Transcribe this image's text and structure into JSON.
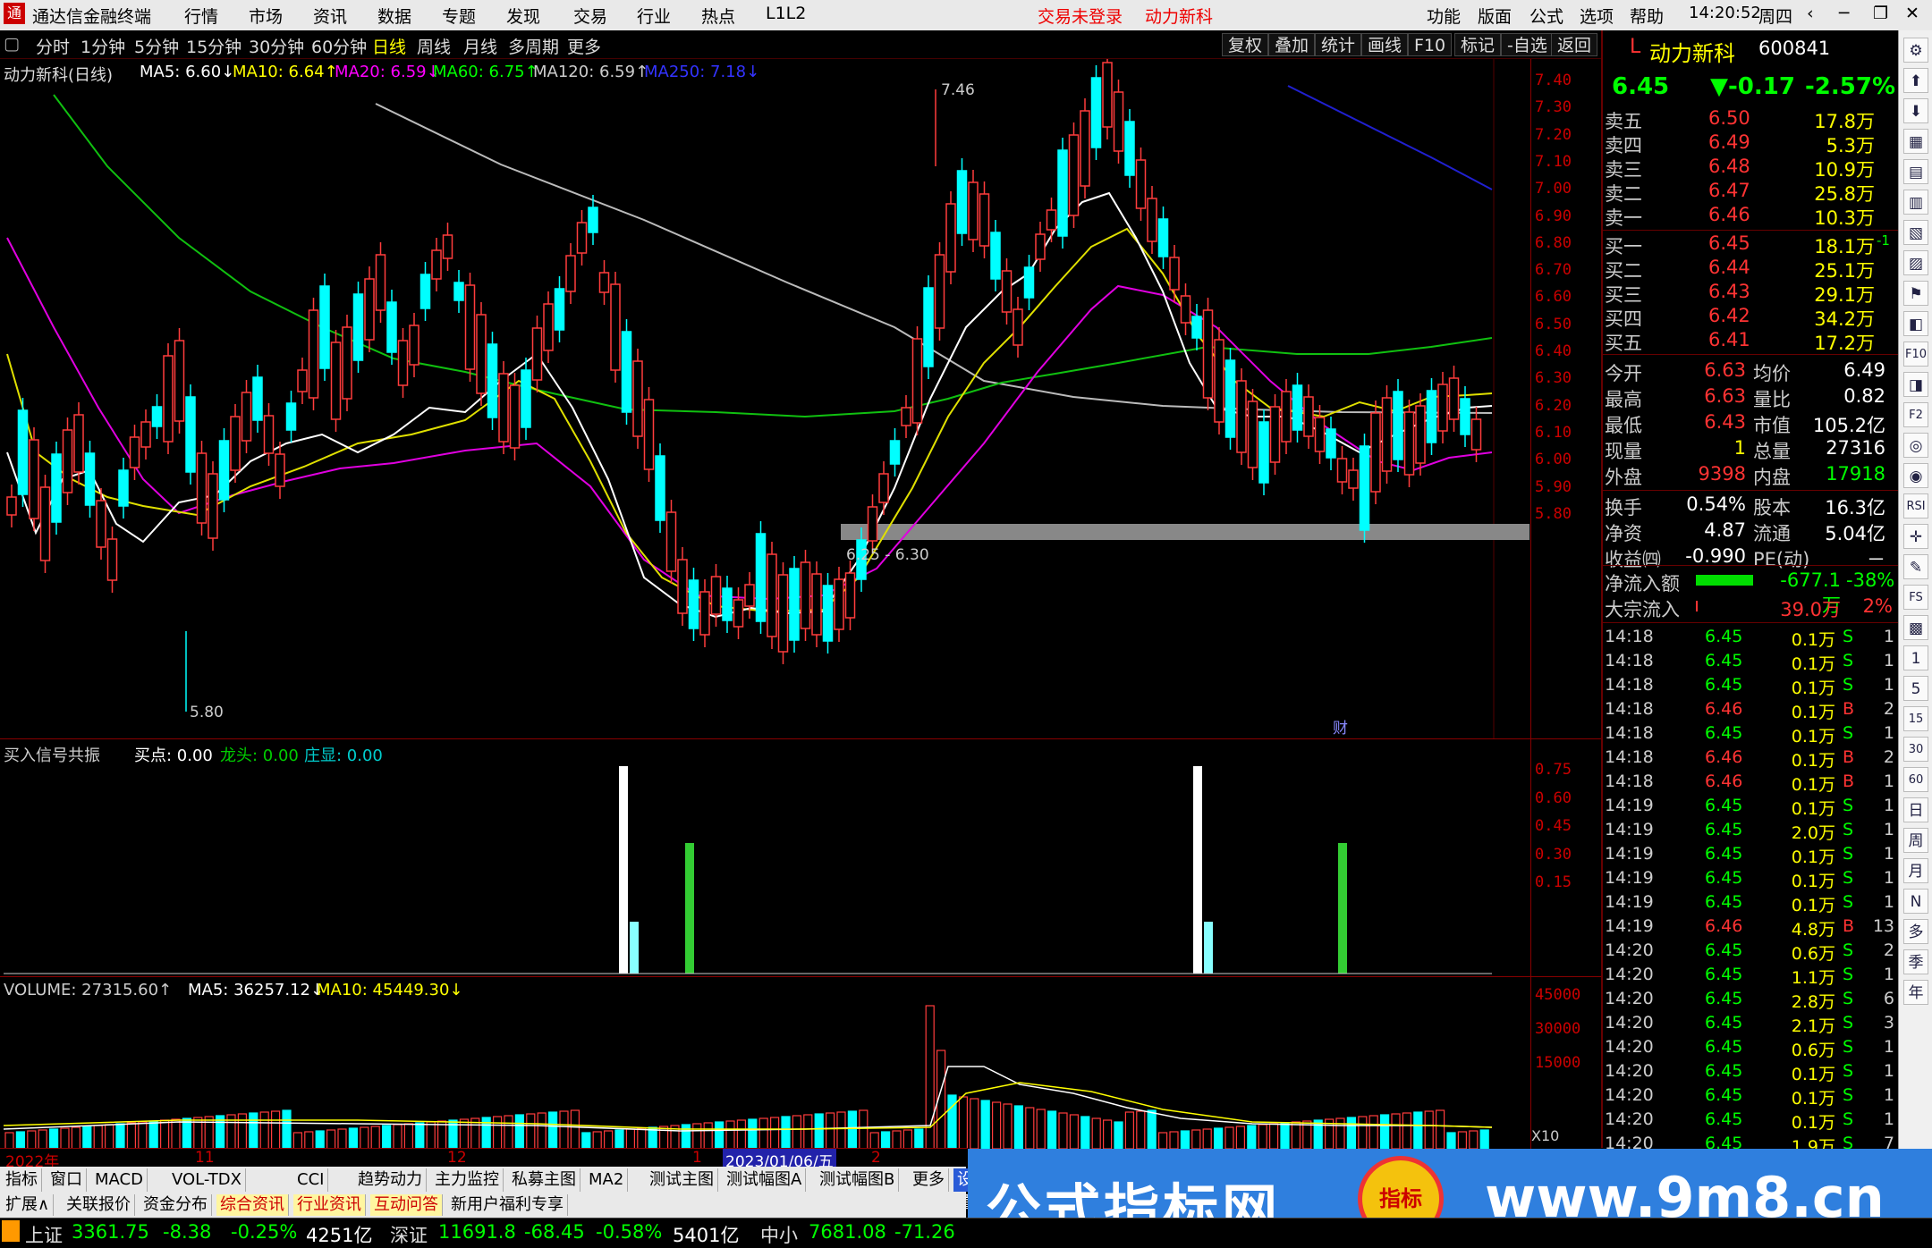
{
  "menubar": {
    "app": "通达信金融终端",
    "menus": [
      "行情",
      "市场",
      "资讯",
      "数据",
      "专题",
      "发现",
      "交易",
      "行业",
      "热点",
      "L1L2"
    ],
    "notice1": "交易未登录",
    "notice2": "动力新科",
    "right": [
      "功能",
      "版面",
      "公式",
      "选项",
      "帮助"
    ],
    "time": "14:20:52",
    "weekday": "周四"
  },
  "period": {
    "items": [
      "分时",
      "1分钟",
      "5分钟",
      "15分钟",
      "30分钟",
      "60分钟",
      "日线",
      "周线",
      "月线",
      "多周期",
      "更多"
    ],
    "active": "日线",
    "tools": [
      "复权",
      "叠加",
      "统计",
      "画线",
      "F10",
      "标记",
      "-自选",
      "返回"
    ]
  },
  "main": {
    "title": "动力新科(日线)",
    "ma": [
      {
        "label": "MA5: 6.60↓",
        "color": "#ffffff"
      },
      {
        "label": "MA10: 6.64↑",
        "color": "#ffff00"
      },
      {
        "label": "MA20: 6.59↓",
        "color": "#ff00ff"
      },
      {
        "label": "MA60: 6.75↑",
        "color": "#00ff00"
      },
      {
        "label": "MA120: 6.59↑",
        "color": "#cccccc"
      },
      {
        "label": "MA250: 7.18↓",
        "color": "#0000ff"
      }
    ],
    "hi_label": "7.46",
    "lo_label": "5.80",
    "zone_label": "6.25 - 6.30",
    "cai": "财"
  },
  "axis_main": [
    "7.40",
    "7.30",
    "7.20",
    "7.10",
    "7.00",
    "6.90",
    "6.80",
    "6.70",
    "6.60",
    "6.50",
    "6.40",
    "6.30",
    "6.20",
    "6.10",
    "6.00",
    "5.90",
    "5.80"
  ],
  "sub": {
    "title": "买入信号共振",
    "a": "买点: 0.00",
    "b": "龙头: 0.00",
    "c": "庄显: 0.00",
    "axis": [
      "0.75",
      "0.60",
      "0.45",
      "0.30",
      "0.15"
    ]
  },
  "vol": {
    "title": "VOLUME: 27315.60↑",
    "ma5": "MA5: 36257.12↓",
    "ma10": "MA10: 45449.30↓",
    "axis": [
      "45000",
      "30000",
      "15000"
    ],
    "unit": "X10"
  },
  "dates": {
    "d1": "2022年",
    "d2": "11",
    "d3": "12",
    "d4": "1",
    "sel": "2023/01/06/五",
    "d5": "2"
  },
  "tabs1": [
    "指标",
    "窗口",
    "MACD",
    "VOL-TDX",
    "CCI",
    "趋势动力",
    "主力监控",
    "私募主图",
    "MA2",
    "测试主图",
    "测试幅图A",
    "测试幅图B",
    "更多",
    "设置"
  ],
  "tabs2": [
    "扩展∧",
    "关联报价",
    "资金分布",
    "综合资讯",
    "行业资讯",
    "互动问答",
    "新用户福利专享"
  ],
  "quote": {
    "name": "动力新科",
    "code": "600841",
    "price": "6.45",
    "chg": "▼-0.17",
    "pct": "-2.57%",
    "sells": [
      {
        "l": "卖五",
        "p": "6.50",
        "v": "17.8万"
      },
      {
        "l": "卖四",
        "p": "6.49",
        "v": "5.3万"
      },
      {
        "l": "卖三",
        "p": "6.48",
        "v": "10.9万"
      },
      {
        "l": "卖二",
        "p": "6.47",
        "v": "25.8万"
      },
      {
        "l": "卖一",
        "p": "6.46",
        "v": "10.3万"
      }
    ],
    "buys": [
      {
        "l": "买一",
        "p": "6.45",
        "v": "18.1万",
        "x": "-1"
      },
      {
        "l": "买二",
        "p": "6.44",
        "v": "25.1万",
        "x": ""
      },
      {
        "l": "买三",
        "p": "6.43",
        "v": "29.1万",
        "x": ""
      },
      {
        "l": "买四",
        "p": "6.42",
        "v": "34.2万",
        "x": ""
      },
      {
        "l": "买五",
        "p": "6.41",
        "v": "17.2万",
        "x": ""
      }
    ],
    "stats": [
      [
        "今开",
        "6.63",
        "均价",
        "6.49"
      ],
      [
        "最高",
        "6.63",
        "量比",
        "0.82"
      ],
      [
        "最低",
        "6.43",
        "市值",
        "105.2亿"
      ],
      [
        "现量",
        "1",
        "总量",
        "27316"
      ],
      [
        "外盘",
        "9398",
        "内盘",
        "17918"
      ]
    ],
    "stats2": [
      [
        "换手",
        "0.54%",
        "股本",
        "16.3亿"
      ],
      [
        "净资",
        "4.87",
        "流通",
        "5.04亿"
      ],
      [
        "收益㈣",
        "-0.990",
        "PE(动)",
        "－"
      ]
    ],
    "flow": [
      {
        "l": "净流入额",
        "v": "-677.1万",
        "p": "-38%"
      },
      {
        "l": "大宗流入",
        "v": "39.0万",
        "p": "2%"
      }
    ]
  },
  "ticks": [
    [
      "14:18",
      "6.45",
      "0.1万",
      "S",
      "1"
    ],
    [
      "14:18",
      "6.45",
      "0.1万",
      "S",
      "1"
    ],
    [
      "14:18",
      "6.45",
      "0.1万",
      "S",
      "1"
    ],
    [
      "14:18",
      "6.46",
      "0.1万",
      "B",
      "2"
    ],
    [
      "14:18",
      "6.45",
      "0.1万",
      "S",
      "1"
    ],
    [
      "14:18",
      "6.46",
      "0.1万",
      "B",
      "2"
    ],
    [
      "14:18",
      "6.46",
      "0.1万",
      "B",
      "1"
    ],
    [
      "14:19",
      "6.45",
      "0.1万",
      "S",
      "1"
    ],
    [
      "14:19",
      "6.45",
      "2.0万",
      "S",
      "1"
    ],
    [
      "14:19",
      "6.45",
      "0.1万",
      "S",
      "1"
    ],
    [
      "14:19",
      "6.45",
      "0.1万",
      "S",
      "1"
    ],
    [
      "14:19",
      "6.45",
      "0.1万",
      "S",
      "1"
    ],
    [
      "14:19",
      "6.46",
      "4.8万",
      "B",
      "13"
    ],
    [
      "14:20",
      "6.45",
      "0.6万",
      "S",
      "2"
    ],
    [
      "14:20",
      "6.45",
      "1.1万",
      "S",
      "1"
    ],
    [
      "14:20",
      "6.45",
      "2.8万",
      "S",
      "6"
    ],
    [
      "14:20",
      "6.45",
      "2.1万",
      "S",
      "3"
    ],
    [
      "14:20",
      "6.45",
      "0.6万",
      "S",
      "1"
    ],
    [
      "14:20",
      "6.45",
      "0.1万",
      "S",
      "1"
    ],
    [
      "14:20",
      "6.45",
      "0.1万",
      "S",
      "1"
    ],
    [
      "14:20",
      "6.45",
      "0.1万",
      "S",
      "1"
    ],
    [
      "14:20",
      "6.45",
      "1.9万",
      "S",
      "7"
    ]
  ],
  "sideicons": [
    "⚙",
    "⬆",
    "⬇",
    "▦",
    "▤",
    "▥",
    "▧",
    "▨",
    "⚑",
    "◧",
    "F10",
    "◨",
    "F2",
    "◎",
    "◉",
    "RSI",
    "✛",
    "✎",
    "FS",
    "▩",
    "1",
    "5",
    "15",
    "30",
    "60",
    "日",
    "周",
    "月",
    "N",
    "多",
    "季",
    "年"
  ],
  "status": {
    "sh": "上证",
    "sh_v": "3361.75",
    "sh_c": "-8.38",
    "sh_p": "-0.25%",
    "sh_a": "4251亿",
    "sz": "深证",
    "sz_v": "11691.8",
    "sz_c": "-68.45",
    "sz_p": "-0.58%",
    "sz_a": "5401亿",
    "zx": "中小",
    "zx_v": "7681.08",
    "zx_c": "-71.26"
  },
  "banner": {
    "text": "公式指标网",
    "url": "www.9m8.cn",
    "logo": "指标"
  },
  "colors": {
    "up": "#ff3c3c",
    "down": "#00ffff",
    "ma5": "#ffffff",
    "ma10": "#ffff00",
    "ma20": "#ff00ff",
    "ma60": "#00ff00",
    "ma120": "#cccccc",
    "ma250": "#0000ff"
  }
}
